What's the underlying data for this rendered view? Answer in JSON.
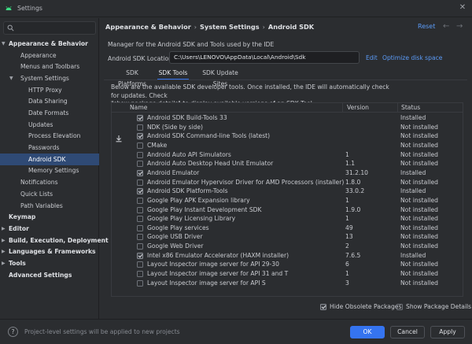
{
  "window": {
    "title": "Settings"
  },
  "search": {
    "placeholder": ""
  },
  "sidebar": {
    "items": [
      {
        "label": "Appearance & Behavior",
        "level": 0,
        "bold": true,
        "expanded": true
      },
      {
        "label": "Appearance",
        "level": 1
      },
      {
        "label": "Menus and Toolbars",
        "level": 1
      },
      {
        "label": "System Settings",
        "level": 1,
        "expanded": true
      },
      {
        "label": "HTTP Proxy",
        "level": 2
      },
      {
        "label": "Data Sharing",
        "level": 2
      },
      {
        "label": "Date Formats",
        "level": 2
      },
      {
        "label": "Updates",
        "level": 2
      },
      {
        "label": "Process Elevation",
        "level": 2
      },
      {
        "label": "Passwords",
        "level": 2
      },
      {
        "label": "Android SDK",
        "level": 2,
        "selected": true
      },
      {
        "label": "Memory Settings",
        "level": 2
      },
      {
        "label": "Notifications",
        "level": 1
      },
      {
        "label": "Quick Lists",
        "level": 1
      },
      {
        "label": "Path Variables",
        "level": 1
      },
      {
        "label": "Keymap",
        "level": 0,
        "bold": true
      },
      {
        "label": "Editor",
        "level": 0,
        "bold": true,
        "collapsed": true
      },
      {
        "label": "Build, Execution, Deployment",
        "level": 0,
        "bold": true,
        "collapsed": true
      },
      {
        "label": "Languages & Frameworks",
        "level": 0,
        "bold": true,
        "collapsed": true
      },
      {
        "label": "Tools",
        "level": 0,
        "bold": true,
        "collapsed": true
      },
      {
        "label": "Advanced Settings",
        "level": 0,
        "bold": true
      }
    ]
  },
  "header": {
    "breadcrumb": [
      "Appearance & Behavior",
      "System Settings",
      "Android SDK"
    ],
    "separator": "›",
    "reset_label": "Reset"
  },
  "main": {
    "description": "Manager for the Android SDK and Tools used by the IDE",
    "location_label": "Android SDK Location:",
    "location_value": "C:\\Users\\LENOVO\\AppData\\Local\\Android\\Sdk",
    "edit_label": "Edit",
    "optimize_label": "Optimize disk space",
    "tabs": [
      {
        "label": "SDK Platforms",
        "active": false
      },
      {
        "label": "SDK Tools",
        "active": true
      },
      {
        "label": "SDK Update Sites",
        "active": false
      }
    ],
    "info_line1": "Below are the available SDK developer tools. Once installed, the IDE will automatically check for updates. Check",
    "info_line2": "\"show package details\" to display available versions of an SDK Tool."
  },
  "table": {
    "columns": [
      "Name",
      "Version",
      "Status"
    ],
    "rows": [
      {
        "name": "Android SDK Build-Tools 33",
        "version": "",
        "status": "Installed",
        "checked": true
      },
      {
        "name": "NDK (Side by side)",
        "version": "",
        "status": "Not installed",
        "checked": false
      },
      {
        "name": "Android SDK Command-line Tools (latest)",
        "version": "",
        "status": "Not installed",
        "checked": true,
        "download": true
      },
      {
        "name": "CMake",
        "version": "",
        "status": "Not installed",
        "checked": false
      },
      {
        "name": "Android Auto API Simulators",
        "version": "1",
        "status": "Not installed",
        "checked": false
      },
      {
        "name": "Android Auto Desktop Head Unit Emulator",
        "version": "1.1",
        "status": "Not installed",
        "checked": false
      },
      {
        "name": "Android Emulator",
        "version": "31.2.10",
        "status": "Installed",
        "checked": true
      },
      {
        "name": "Android Emulator Hypervisor Driver for AMD Processors (installer)",
        "version": "1.8.0",
        "status": "Not installed",
        "checked": false
      },
      {
        "name": "Android SDK Platform-Tools",
        "version": "33.0.2",
        "status": "Installed",
        "checked": true
      },
      {
        "name": "Google Play APK Expansion library",
        "version": "1",
        "status": "Not installed",
        "checked": false
      },
      {
        "name": "Google Play Instant Development SDK",
        "version": "1.9.0",
        "status": "Not installed",
        "checked": false
      },
      {
        "name": "Google Play Licensing Library",
        "version": "1",
        "status": "Not installed",
        "checked": false
      },
      {
        "name": "Google Play services",
        "version": "49",
        "status": "Not installed",
        "checked": false
      },
      {
        "name": "Google USB Driver",
        "version": "13",
        "status": "Not installed",
        "checked": false
      },
      {
        "name": "Google Web Driver",
        "version": "2",
        "status": "Not installed",
        "checked": false
      },
      {
        "name": "Intel x86 Emulator Accelerator (HAXM installer)",
        "version": "7.6.5",
        "status": "Installed",
        "checked": true
      },
      {
        "name": "Layout Inspector image server for API 29-30",
        "version": "6",
        "status": "Not installed",
        "checked": false
      },
      {
        "name": "Layout Inspector image server for API 31 and T",
        "version": "1",
        "status": "Not installed",
        "checked": false
      },
      {
        "name": "Layout Inspector image server for API S",
        "version": "3",
        "status": "Not installed",
        "checked": false
      }
    ]
  },
  "options": {
    "hide_obsolete_label": "Hide Obsolete Packages",
    "hide_obsolete_checked": true,
    "show_details_label": "Show Package Details",
    "show_details_checked": false
  },
  "footer": {
    "note": "Project-level settings will be applied to new projects",
    "help": "?",
    "ok_label": "OK",
    "cancel_label": "Cancel",
    "apply_label": "Apply"
  },
  "colors": {
    "accent": "#3574f0",
    "selection": "#2f4a75",
    "link": "#5b9bf7",
    "android_green": "#3ddc84"
  },
  "icons": [
    "android-icon",
    "close-icon",
    "search-icon",
    "download-icon",
    "help-icon",
    "back-arrow-icon",
    "forward-arrow-icon",
    "chevron-down-icon",
    "chevron-right-icon"
  ]
}
